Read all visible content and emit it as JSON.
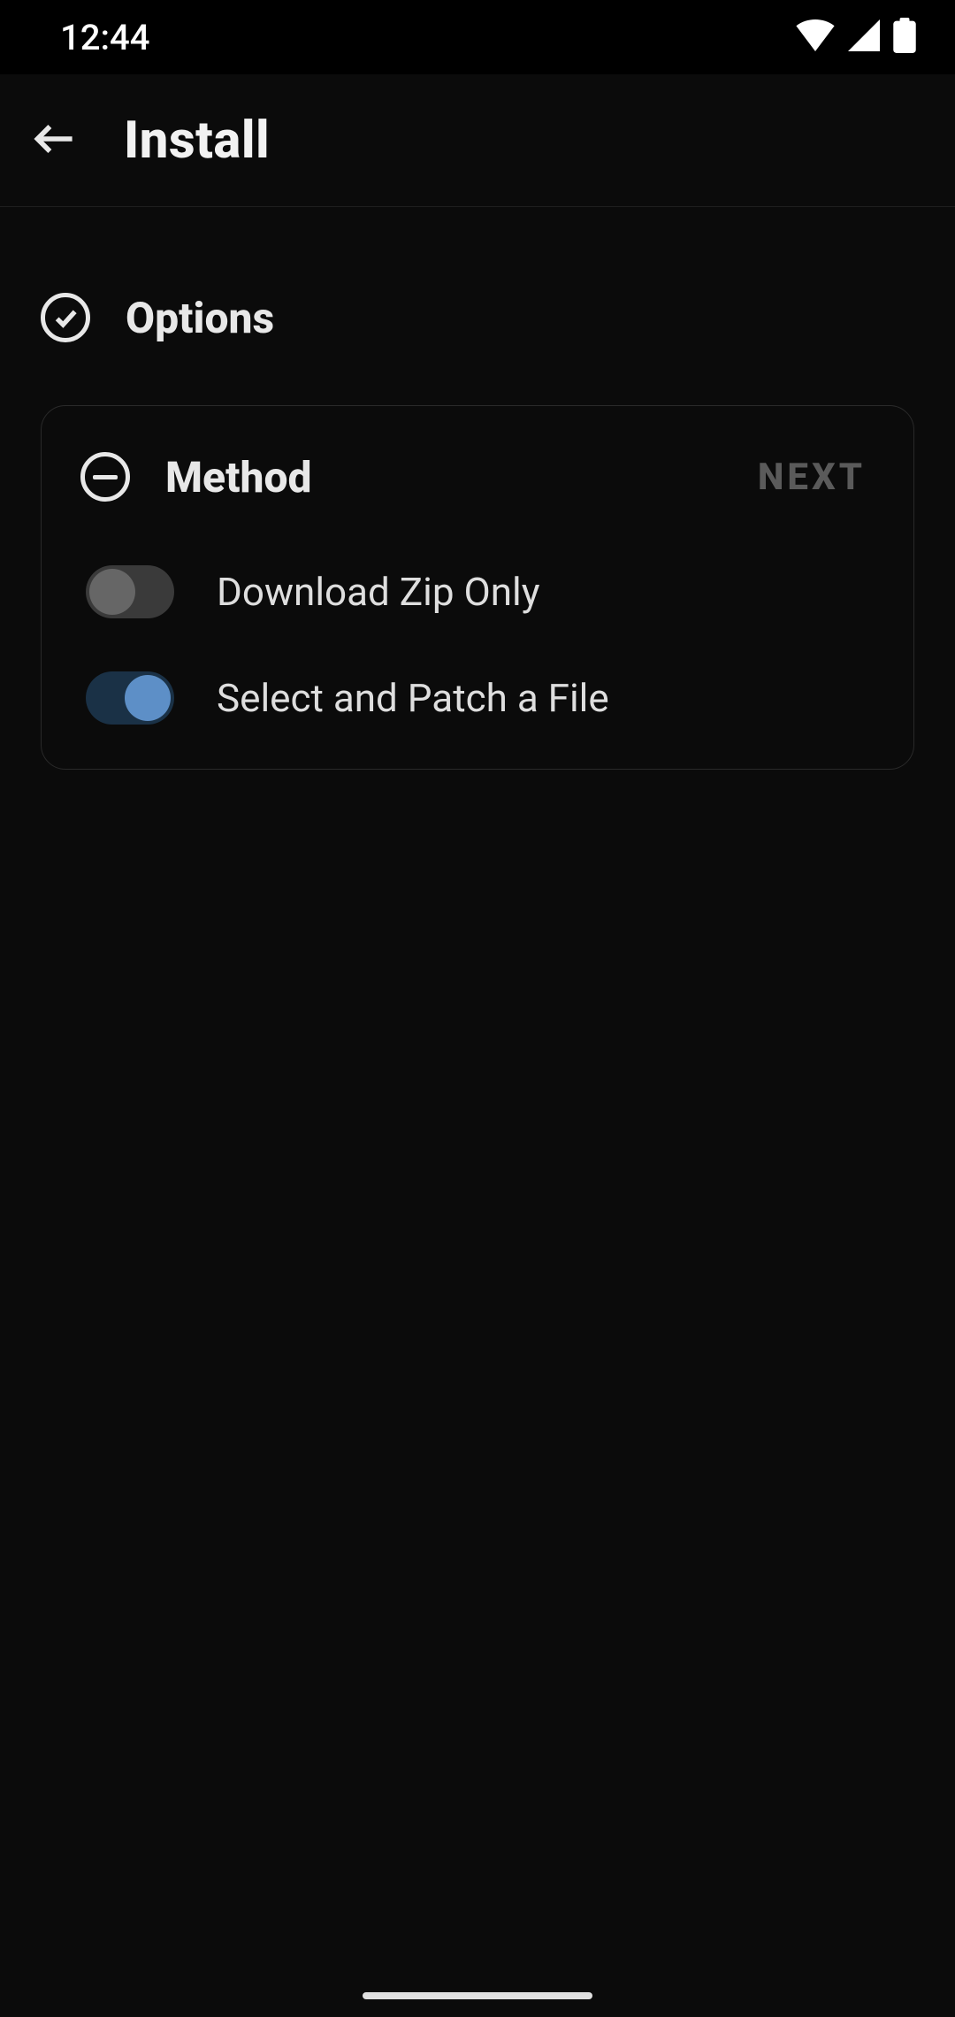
{
  "statusBar": {
    "time": "12:44"
  },
  "appBar": {
    "title": "Install"
  },
  "steps": {
    "options": {
      "label": "Options"
    },
    "method": {
      "label": "Method",
      "nextLabel": "NEXT"
    }
  },
  "methodOptions": [
    {
      "label": "Download Zip Only",
      "checked": false
    },
    {
      "label": "Select and Patch a File",
      "checked": true
    }
  ],
  "icons": {
    "back": "arrow-left-icon",
    "check": "check-circle-icon",
    "minus": "minus-circle-icon",
    "wifi": "wifi-icon",
    "signal": "signal-icon",
    "battery": "battery-icon"
  }
}
